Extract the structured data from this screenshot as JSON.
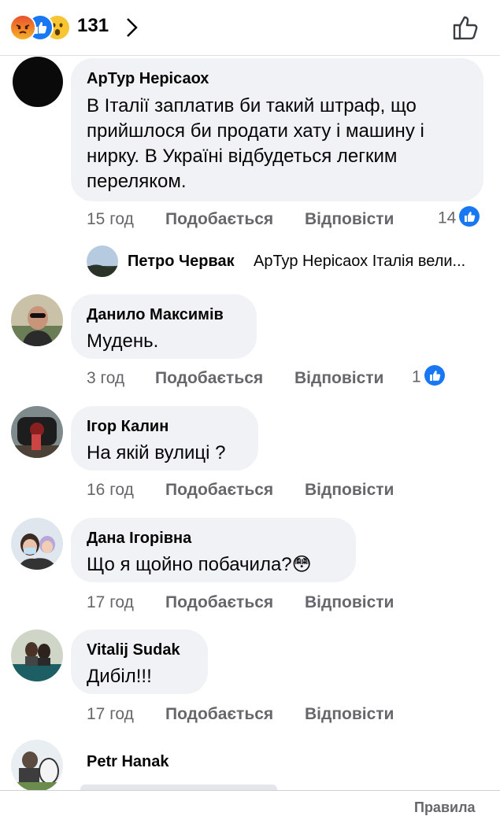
{
  "header": {
    "reaction_count": "131",
    "reactions": [
      "angry-icon",
      "like-icon",
      "wow-icon"
    ]
  },
  "comments": [
    {
      "author": "АрТур Нерісаох",
      "lines": [
        "В Італії заплатив би такий штраф, що",
        "прийшлося би продати хату і машину і",
        "нирку. В Україні відбудеться легким",
        "переляком."
      ],
      "time": "15 год",
      "like_label": "Подобається",
      "reply_label": "Відповісти",
      "likes": "14"
    },
    {
      "author": "Данило Максимів",
      "lines": [
        "Мудень."
      ],
      "time": "3 год",
      "like_label": "Подобається",
      "reply_label": "Відповісти",
      "likes": "1"
    },
    {
      "author": "Ігор Калин",
      "lines": [
        "На якій вулиці ?"
      ],
      "time": "16 год",
      "like_label": "Подобається",
      "reply_label": "Відповісти"
    },
    {
      "author": "Дана Ігорівна",
      "lines": [
        "Що я щойно побачила?😳"
      ],
      "time": "17 год",
      "like_label": "Подобається",
      "reply_label": "Відповісти"
    },
    {
      "author": "Vitalij  Sudak",
      "lines": [
        "Дибіл!!!"
      ],
      "time": "17 год",
      "like_label": "Подобається",
      "reply_label": "Відповісти"
    },
    {
      "author": "Petr Hanak"
    }
  ],
  "reply_preview": {
    "author": "Петро Червак",
    "text": "АрТур Нерісаох Італія вели..."
  },
  "footer": {
    "text": "Правила"
  },
  "colors": {
    "bubble": "#f0f2f5",
    "meta": "#65676b",
    "like_blue": "#1877f2"
  }
}
